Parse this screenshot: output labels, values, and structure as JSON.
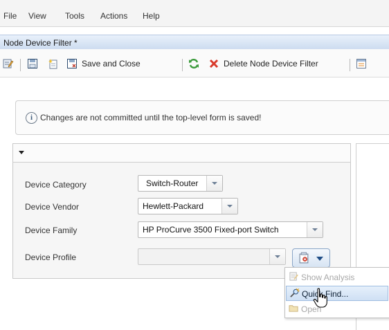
{
  "menu": [
    "File",
    "View",
    "Tools",
    "Actions",
    "Help"
  ],
  "window_title": "Node Device Filter *",
  "toolbar": {
    "save_and_close": "Save and Close",
    "delete_filter": "Delete Node Device Filter"
  },
  "message": "Changes are not committed until the top-level form is saved!",
  "form": {
    "device_category": {
      "label": "Device Category",
      "value": "Switch-Router"
    },
    "device_vendor": {
      "label": "Device Vendor",
      "value": "Hewlett-Packard"
    },
    "device_family": {
      "label": "Device Family",
      "value": "HP ProCurve 3500 Fixed-port Switch"
    },
    "device_profile": {
      "label": "Device Profile",
      "value": ""
    }
  },
  "dropdown": {
    "show_analysis": "Show Analysis",
    "quick_find": "Quick Find...",
    "open": "Open"
  },
  "colors": {
    "accent": "#1f4d86",
    "title_bar": "#cddcf0",
    "disabled_text": "#a8a8a8",
    "delete_red": "#d93a2b",
    "refresh_green": "#3a9a3a"
  }
}
